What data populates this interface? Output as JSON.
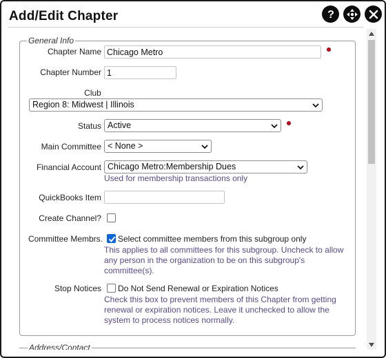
{
  "dialog": {
    "title": "Add/Edit Chapter"
  },
  "titlebar": {
    "help_icon": "question-circle-icon",
    "move_icon": "move-arrows-icon",
    "close_icon": "close-x-icon"
  },
  "general_info": {
    "legend": "General Info",
    "chapter_name": {
      "label": "Chapter Name",
      "value": "Chicago Metro",
      "required": true
    },
    "chapter_number": {
      "label": "Chapter Number",
      "value": "1"
    },
    "club": {
      "label": "Club",
      "selected": "Region 8: Midwest | Illinois"
    },
    "status": {
      "label": "Status",
      "selected": "Active",
      "required": true
    },
    "main_committee": {
      "label": "Main Committee",
      "selected": "< None >"
    },
    "financial_account": {
      "label": "Financial Account",
      "selected": "Chicago Metro:Membership Dues",
      "help": "Used for membership transactions only"
    },
    "quickbooks_item": {
      "label": "QuickBooks Item",
      "value": ""
    },
    "create_channel": {
      "label": "Create Channel?",
      "checked": false
    },
    "committee_members": {
      "label": "Committee Membrs.",
      "checked": true,
      "option_label": "Select committee members from this subgroup only",
      "help": "This applies to all committees for this subgroup. Uncheck to allow any person in the organization to be on this subgroup's committee(s)."
    },
    "stop_notices": {
      "label": "Stop Notices",
      "checked": false,
      "option_label": "Do Not Send Renewal or Expiration Notices",
      "help": "Check this box to prevent members of this Chapter from getting renewal or expiration notices. Leave it unchecked to allow the system to process notices normally."
    }
  },
  "address_contact": {
    "legend": "Address/Contact"
  },
  "colors": {
    "required_dot": "#d0021b",
    "help_text": "#5b4a8a",
    "checkbox_checked": "#0a66d6",
    "titlebar_button": "#0d0d0d"
  }
}
